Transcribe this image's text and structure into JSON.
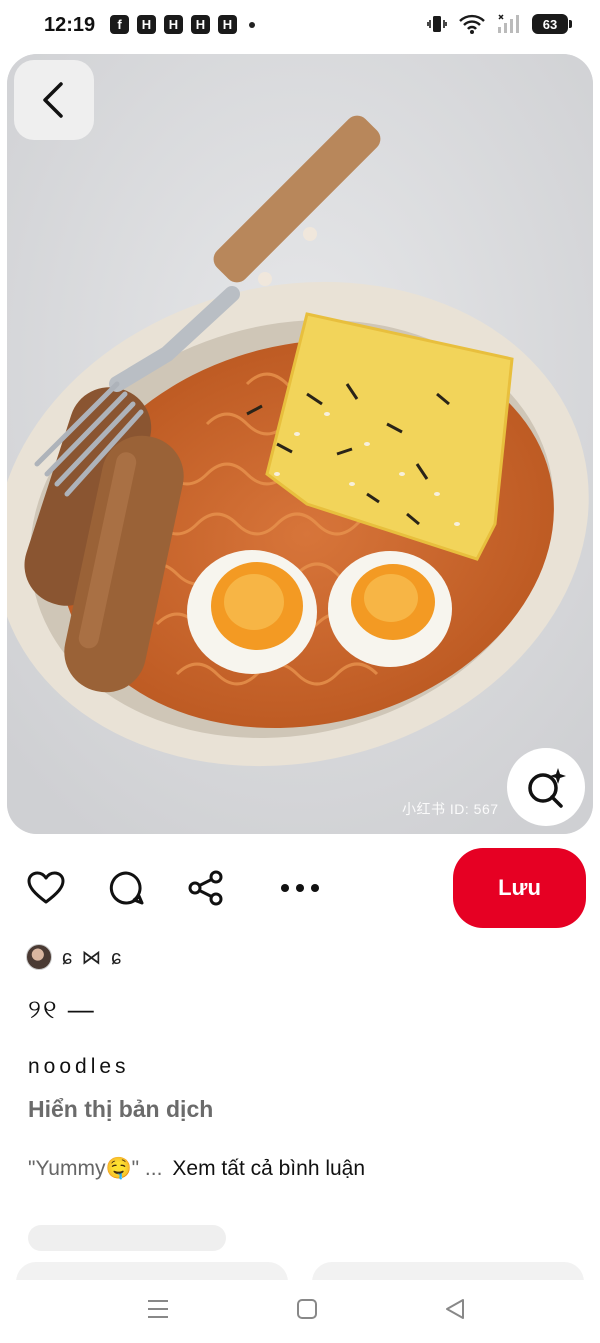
{
  "status_bar": {
    "time": "12:19",
    "notifications": [
      "f",
      "H",
      "H",
      "H",
      "H"
    ],
    "battery": "63"
  },
  "photo": {
    "watermark": "小红书 ID: 567",
    "description_icon": "visual-search-icon"
  },
  "actions": {
    "save_label": "Lưu"
  },
  "pin": {
    "author_name": "ɕ ⋈ ɕ",
    "title": "୨୧ —",
    "description": "noodles",
    "translate_label": "Hiển thị bản dịch",
    "comment_preview": "\"Yummy🤤\" ...",
    "see_all_comments": "Xem tất cả bình luận"
  },
  "colors": {
    "save_button": "#e60023",
    "translate_text": "#6b6b6b"
  }
}
